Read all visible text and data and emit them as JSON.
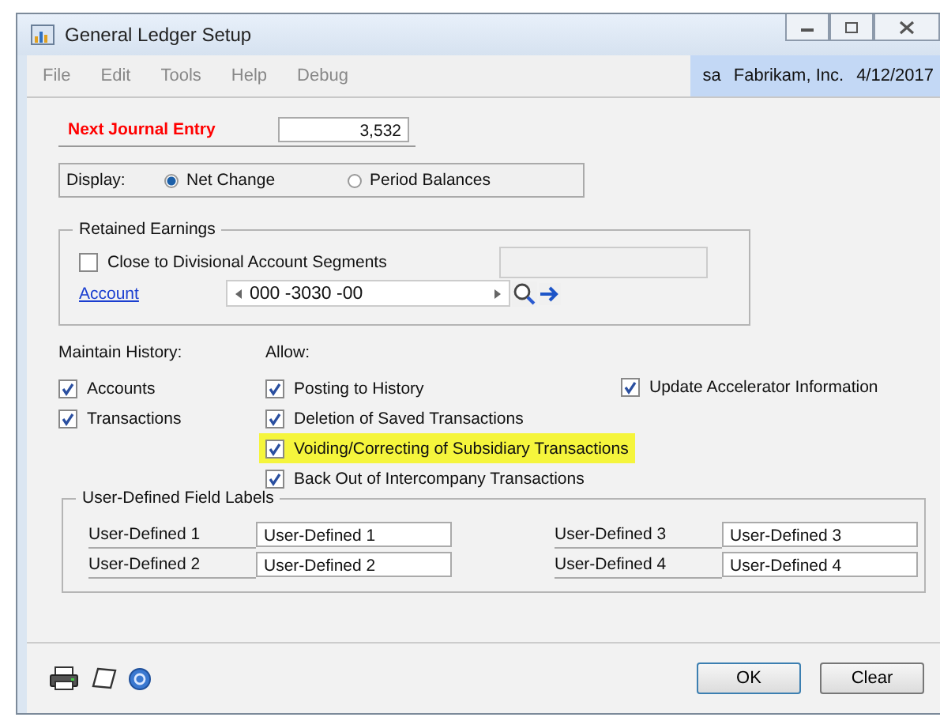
{
  "window": {
    "title": "General Ledger Setup"
  },
  "menu": [
    "File",
    "Edit",
    "Tools",
    "Help",
    "Debug"
  ],
  "user_info": {
    "user": "sa",
    "company": "Fabrikam, Inc.",
    "date": "4/12/2017"
  },
  "next_journal_entry": {
    "label": "Next Journal Entry",
    "value": "3,532"
  },
  "display": {
    "label": "Display:",
    "options": [
      {
        "label": "Net Change",
        "selected": true
      },
      {
        "label": "Period Balances",
        "selected": false
      }
    ]
  },
  "retained_earnings": {
    "title": "Retained Earnings",
    "close_to_divisional": {
      "label": "Close to Divisional Account Segments",
      "checked": false
    },
    "account_link": "Account",
    "account_value": "000 -3030 -00"
  },
  "maintain_history": {
    "title": "Maintain History:",
    "items": [
      {
        "label": "Accounts",
        "checked": true
      },
      {
        "label": "Transactions",
        "checked": true
      }
    ]
  },
  "allow": {
    "title": "Allow:",
    "items": [
      {
        "label": "Posting to History",
        "checked": true,
        "highlighted": false
      },
      {
        "label": "Deletion of Saved Transactions",
        "checked": true,
        "highlighted": false
      },
      {
        "label": "Voiding/Correcting of Subsidiary Transactions",
        "checked": true,
        "highlighted": true
      },
      {
        "label": "Back Out of Intercompany Transactions",
        "checked": true,
        "highlighted": false
      }
    ]
  },
  "update_accelerator": {
    "label": "Update Accelerator Information",
    "checked": true
  },
  "user_defined": {
    "title": "User-Defined Field Labels",
    "fields": [
      {
        "label": "User-Defined 1",
        "value": "User-Defined 1"
      },
      {
        "label": "User-Defined 3",
        "value": "User-Defined 3"
      },
      {
        "label": "User-Defined 2",
        "value": "User-Defined 2"
      },
      {
        "label": "User-Defined 4",
        "value": "User-Defined 4"
      }
    ]
  },
  "buttons": [
    "OK",
    "Clear"
  ]
}
